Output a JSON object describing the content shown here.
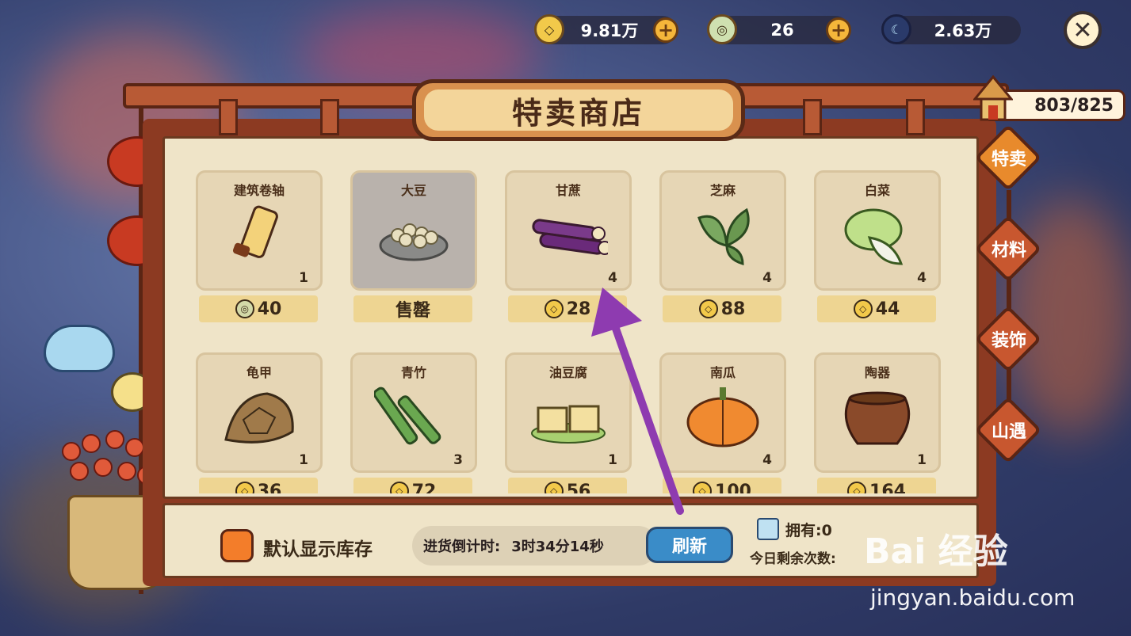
{
  "currencies": [
    {
      "icon": "copper-coin-icon",
      "value": "9.81万",
      "has_plus": true
    },
    {
      "icon": "jade-coin-icon",
      "value": "26",
      "has_plus": true
    },
    {
      "icon": "moon-icon",
      "value": "2.63万",
      "has_plus": false
    }
  ],
  "shop": {
    "title": "特卖商店",
    "capacity": "803/825"
  },
  "tabs": [
    {
      "label": "特卖",
      "active": true
    },
    {
      "label": "材料",
      "active": false
    },
    {
      "label": "装饰",
      "active": false
    },
    {
      "label": "山遇",
      "active": false
    }
  ],
  "items": [
    {
      "name": "建筑卷轴",
      "count": "1",
      "price": "40",
      "currency": "jade",
      "sold": false,
      "icon": "scroll-icon"
    },
    {
      "name": "大豆",
      "count": "",
      "price": "售罄",
      "currency": "",
      "sold": true,
      "icon": "soybean-icon"
    },
    {
      "name": "甘蔗",
      "count": "4",
      "price": "28",
      "currency": "copper",
      "sold": false,
      "icon": "sugarcane-icon"
    },
    {
      "name": "芝麻",
      "count": "4",
      "price": "88",
      "currency": "copper",
      "sold": false,
      "icon": "sesame-icon"
    },
    {
      "name": "白菜",
      "count": "4",
      "price": "44",
      "currency": "copper",
      "sold": false,
      "icon": "cabbage-icon"
    },
    {
      "name": "龟甲",
      "count": "1",
      "price": "36",
      "currency": "copper",
      "sold": false,
      "icon": "tortoise-shell-icon"
    },
    {
      "name": "青竹",
      "count": "3",
      "price": "72",
      "currency": "copper",
      "sold": false,
      "icon": "bamboo-icon"
    },
    {
      "name": "油豆腐",
      "count": "1",
      "price": "56",
      "currency": "copper",
      "sold": false,
      "icon": "tofu-icon"
    },
    {
      "name": "南瓜",
      "count": "4",
      "price": "100",
      "currency": "copper",
      "sold": false,
      "icon": "pumpkin-icon"
    },
    {
      "name": "陶器",
      "count": "1",
      "price": "164",
      "currency": "copper",
      "sold": false,
      "icon": "pottery-icon"
    }
  ],
  "footer": {
    "toggle_label": "默认显示库存",
    "timer_label": "进货倒计时:",
    "timer_value": "3时34分14秒",
    "refresh_label": "刷新",
    "own_label": "拥有:0",
    "remain_label": "今日剩余次数:"
  },
  "watermark": {
    "brand": "Bai 经验",
    "url": "jingyan.baidu.com"
  },
  "colors": {
    "frame": "#8c3a22",
    "parchment": "#efe4c8",
    "price_bar": "#eed592",
    "refresh": "#3a8cc8",
    "arrow": "#8e3bb0"
  }
}
